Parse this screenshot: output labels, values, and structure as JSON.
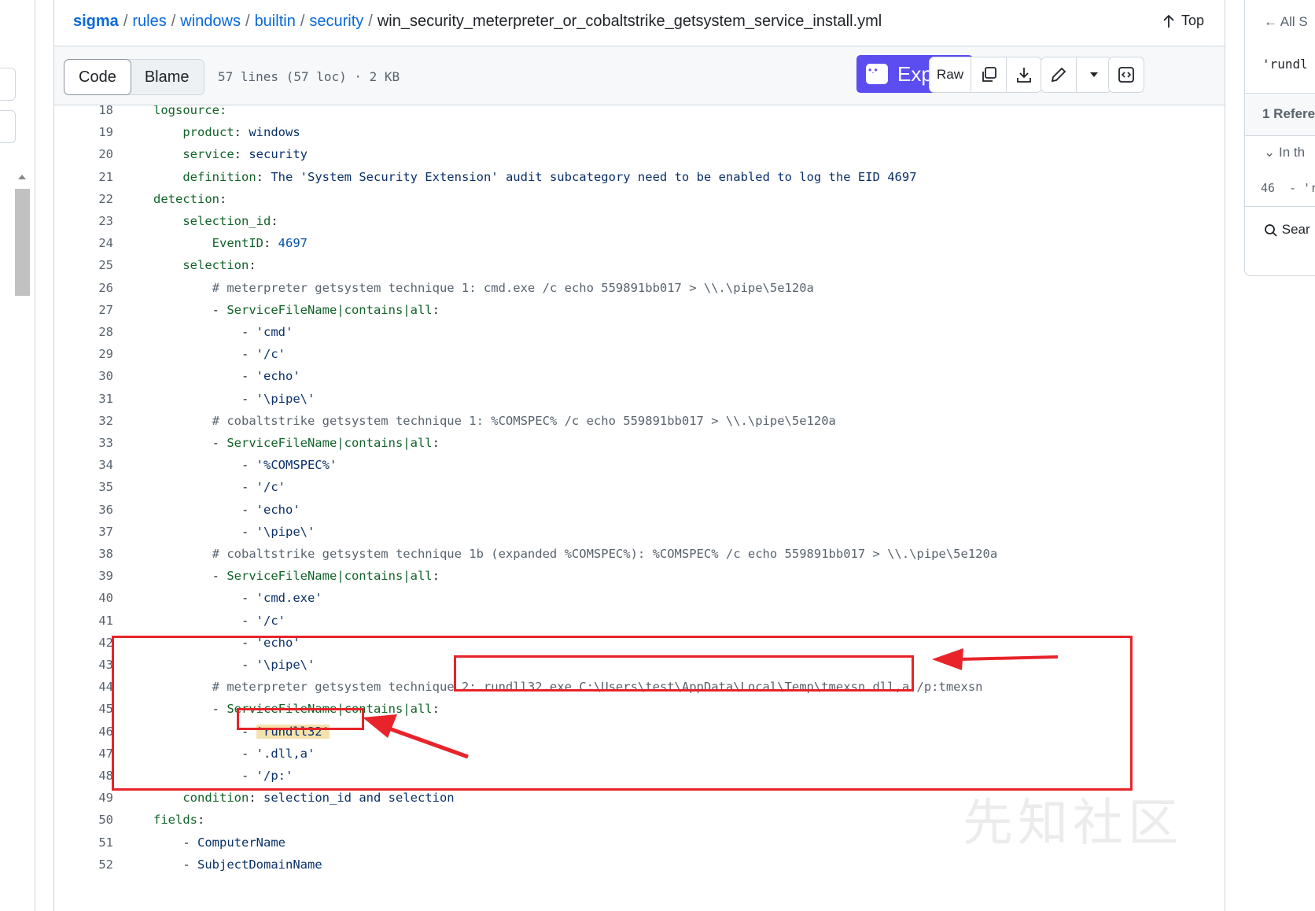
{
  "breadcrumb": {
    "repo": "sigma",
    "parts": [
      "rules",
      "windows",
      "builtin",
      "security"
    ],
    "file": "win_security_meterpreter_or_cobaltstrike_getsystem_service_install.yml",
    "top_label": "Top"
  },
  "toolbar": {
    "code_label": "Code",
    "blame_label": "Blame",
    "file_info": "57 lines (57 loc) · 2 KB",
    "explain_label": "Explain",
    "raw_label": "Raw"
  },
  "code_lines": [
    {
      "n": "18",
      "text": "logsource:"
    },
    {
      "n": "19",
      "indent": "    ",
      "key": "product",
      "val": "windows"
    },
    {
      "n": "20",
      "indent": "    ",
      "key": "service",
      "val": "security"
    },
    {
      "n": "21",
      "indent": "    ",
      "key": "definition",
      "val": "The 'System Security Extension' audit subcategory need to be enabled to log the EID 4697"
    },
    {
      "n": "22",
      "indent": "",
      "key": "detection",
      "val": ""
    },
    {
      "n": "23",
      "indent": "    ",
      "key": "selection_id",
      "val": ""
    },
    {
      "n": "24",
      "indent": "        ",
      "key": "EventID",
      "num": "4697"
    },
    {
      "n": "25",
      "indent": "    ",
      "key": "selection",
      "val": ""
    },
    {
      "n": "26",
      "indent": "        ",
      "comment": "# meterpreter getsystem technique 1: cmd.exe /c echo 559891bb017 > \\\\.\\pipe\\5e120a"
    },
    {
      "n": "27",
      "indent": "        ",
      "dash": "- ",
      "key": "ServiceFileName|contains|all",
      "val": ""
    },
    {
      "n": "28",
      "indent": "            ",
      "item": "'cmd'"
    },
    {
      "n": "29",
      "indent": "            ",
      "item": "'/c'"
    },
    {
      "n": "30",
      "indent": "            ",
      "item": "'echo'"
    },
    {
      "n": "31",
      "indent": "            ",
      "item": "'\\pipe\\'"
    },
    {
      "n": "32",
      "indent": "        ",
      "comment": "# cobaltstrike getsystem technique 1: %COMSPEC% /c echo 559891bb017 > \\\\.\\pipe\\5e120a"
    },
    {
      "n": "33",
      "indent": "        ",
      "dash": "- ",
      "key": "ServiceFileName|contains|all",
      "val": ""
    },
    {
      "n": "34",
      "indent": "            ",
      "item": "'%COMSPEC%'"
    },
    {
      "n": "35",
      "indent": "            ",
      "item": "'/c'"
    },
    {
      "n": "36",
      "indent": "            ",
      "item": "'echo'"
    },
    {
      "n": "37",
      "indent": "            ",
      "item": "'\\pipe\\'"
    },
    {
      "n": "38",
      "indent": "        ",
      "comment": "# cobaltstrike getsystem technique 1b (expanded %COMSPEC%): %COMSPEC% /c echo 559891bb017 > \\\\.\\pipe\\5e120a"
    },
    {
      "n": "39",
      "indent": "        ",
      "dash": "- ",
      "key": "ServiceFileName|contains|all",
      "val": ""
    },
    {
      "n": "40",
      "indent": "            ",
      "item": "'cmd.exe'"
    },
    {
      "n": "41",
      "indent": "            ",
      "item": "'/c'"
    },
    {
      "n": "42",
      "indent": "            ",
      "item": "'echo'"
    },
    {
      "n": "43",
      "indent": "            ",
      "item": "'\\pipe\\'"
    },
    {
      "n": "44",
      "indent": "        ",
      "comment": "# meterpreter getsystem technique 2: rundll32.exe C:\\Users\\test\\AppData\\Local\\Temp\\tmexsn.dll,a /p:tmexsn"
    },
    {
      "n": "45",
      "indent": "        ",
      "dash": "- ",
      "key": "ServiceFileName|contains|all",
      "val": ""
    },
    {
      "n": "46",
      "indent": "            ",
      "item": "'rundll32'",
      "highlight": true
    },
    {
      "n": "47",
      "indent": "            ",
      "item": "'.dll,a'"
    },
    {
      "n": "48",
      "indent": "            ",
      "item": "'/p:'"
    },
    {
      "n": "49",
      "indent": "    ",
      "key": "condition",
      "val": "selection_id and selection"
    },
    {
      "n": "50",
      "indent": "",
      "key": "fields",
      "val": ""
    },
    {
      "n": "51",
      "indent": "    ",
      "item": "ComputerName",
      "itemcolor": "v"
    },
    {
      "n": "52",
      "indent": "    ",
      "item": "SubjectDomainName",
      "itemcolor": "v"
    }
  ],
  "right_panel": {
    "back_label": "All S",
    "symbol": "'rundl",
    "references": "1 Refere",
    "in_label": "In th",
    "ref_line": "46",
    "ref_text": "- 'r",
    "search_label": "Sear"
  },
  "watermark": "先知社区",
  "colors": {
    "link": "#0969da",
    "explain_bg": "#5b4df0",
    "annotation": "#e8232a",
    "highlight": "#f3e2ad"
  }
}
